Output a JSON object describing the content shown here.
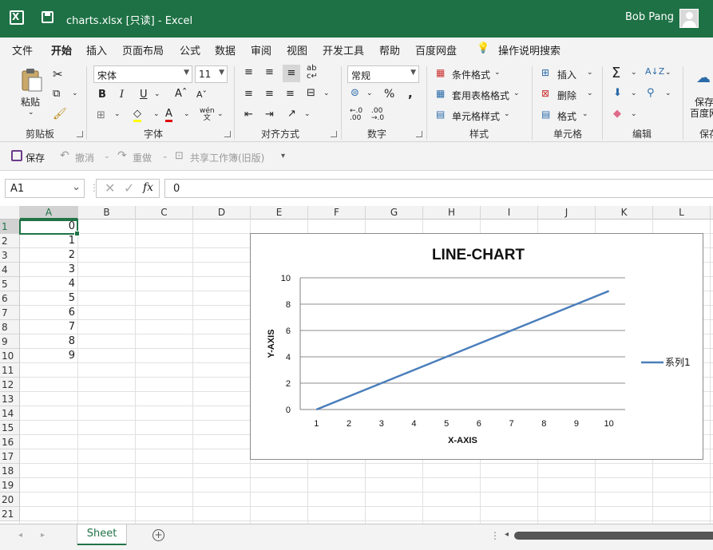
{
  "titlebar": {
    "title": "charts.xlsx  [只读]  -  Excel",
    "user": "Bob Pang"
  },
  "tabs": [
    "文件",
    "开始",
    "插入",
    "页面布局",
    "公式",
    "数据",
    "审阅",
    "视图",
    "开发工具",
    "帮助",
    "百度网盘",
    "操作说明搜索"
  ],
  "ribbon": {
    "paste": "粘贴",
    "font_name": "宋体",
    "font_size": "11",
    "number_format": "常规",
    "percent": "%",
    "comma": ",",
    "conditional_format": "条件格式",
    "table_format": "套用表格格式",
    "cell_style": "单元格样式",
    "insert": "插入",
    "delete": "删除",
    "format": "格式",
    "save_to": "保存",
    "save_to2": "百度网",
    "groups": {
      "clipboard": "剪贴板",
      "font": "字体",
      "alignment": "对齐方式",
      "number": "数字",
      "styles": "样式",
      "cells": "单元格",
      "editing": "编辑",
      "save": "保存"
    }
  },
  "qat": {
    "save": "保存",
    "undo": "撤消",
    "redo": "重做",
    "share": "共享工作簿(旧版)"
  },
  "formula_bar": {
    "name_box": "A1",
    "fx": "fx",
    "value": "0"
  },
  "columns": [
    "A",
    "B",
    "C",
    "D",
    "E",
    "F",
    "G",
    "H",
    "I",
    "J",
    "K",
    "L"
  ],
  "rows": [
    "1",
    "2",
    "3",
    "4",
    "5",
    "6",
    "7",
    "8",
    "9",
    "10",
    "11",
    "12",
    "13",
    "14",
    "15",
    "16",
    "17",
    "18",
    "19",
    "20",
    "21"
  ],
  "cells_a": [
    "0",
    "1",
    "2",
    "3",
    "4",
    "5",
    "6",
    "7",
    "8",
    "9"
  ],
  "chart_data": {
    "type": "line",
    "title": "LINE-CHART",
    "xlabel": "X-AXIS",
    "ylabel": "Y-AXIS",
    "categories": [
      "1",
      "2",
      "3",
      "4",
      "5",
      "6",
      "7",
      "8",
      "9",
      "10"
    ],
    "series": [
      {
        "name": "系列1",
        "values": [
          0,
          1,
          2,
          3,
          4,
          5,
          6,
          7,
          8,
          9
        ],
        "color": "#4a7ebb"
      }
    ],
    "ylim": [
      0,
      10
    ],
    "yticks": [
      "0",
      "2",
      "4",
      "6",
      "8",
      "10"
    ],
    "grid": true,
    "legend": "right"
  },
  "sheets": [
    "Sheet"
  ],
  "colors": {
    "excel_green": "#1e7145",
    "accent_green": "#217346",
    "series": "#4a7ebb"
  }
}
